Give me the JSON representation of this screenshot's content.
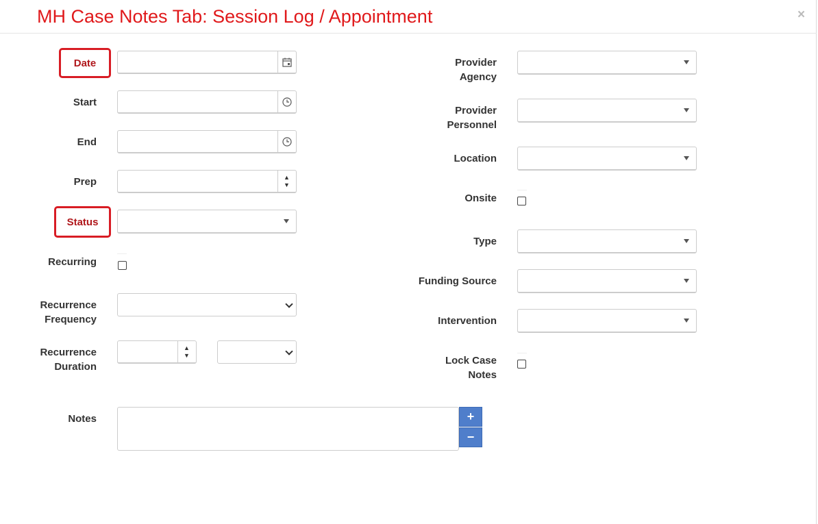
{
  "header": {
    "title": "MH Case Notes Tab: Session Log / Appointment",
    "close": "×"
  },
  "left": {
    "date_label": "Date",
    "start_label": "Start",
    "end_label": "End",
    "prep_label": "Prep",
    "status_label": "Status",
    "recurring_label": "Recurring",
    "recurrence_frequency_label": [
      "Recurrence",
      "Frequency"
    ],
    "recurrence_duration_label": [
      "Recurrence",
      "Duration"
    ],
    "notes_label": "Notes"
  },
  "right": {
    "provider_agency_label": [
      "Provider",
      "Agency"
    ],
    "provider_personnel_label": [
      "Provider",
      "Personnel"
    ],
    "location_label": "Location",
    "onsite_label": "Onsite",
    "type_label": "Type",
    "funding_source_label": "Funding Source",
    "intervention_label": "Intervention",
    "lock_case_notes_label": [
      "Lock Case",
      "Notes"
    ]
  },
  "icons": {
    "calendar": "calendar-icon",
    "clock": "clock-icon",
    "spinner_up": "▲",
    "spinner_down": "▼",
    "plus": "+",
    "minus": "−"
  },
  "colors": {
    "title": "#e0191b",
    "required_border": "#d81c24",
    "button": "#4f7ecb"
  }
}
